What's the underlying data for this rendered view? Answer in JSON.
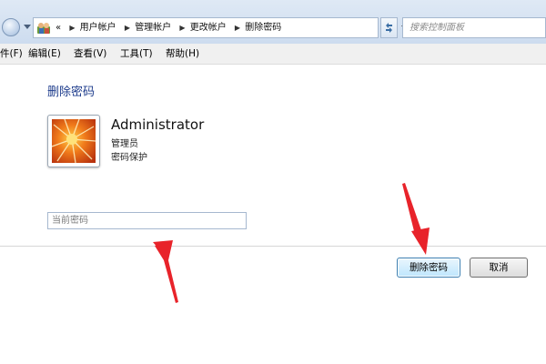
{
  "breadcrumb": {
    "chevron": "«",
    "items": [
      "用户帐户",
      "管理帐户",
      "更改帐户",
      "删除密码"
    ]
  },
  "search": {
    "placeholder": "搜索控制面板"
  },
  "menu": {
    "items": [
      "件(F)",
      "编辑(E)",
      "查看(V)",
      "工具(T)",
      "帮助(H)"
    ]
  },
  "page": {
    "title": "删除密码",
    "user": {
      "name": "Administrator",
      "role": "管理员",
      "protection": "密码保护"
    },
    "password_field": {
      "placeholder": "当前密码",
      "value": ""
    }
  },
  "buttons": {
    "delete": "删除密码",
    "cancel": "取消"
  },
  "icons": {
    "back": "back-arrow-icon",
    "address": "control-panel-users-icon",
    "refresh": "refresh-icon",
    "avatar": "flower-avatar-icon",
    "annotation": "red-arrow-icon"
  },
  "colors": {
    "title": "#1e3c8c",
    "annotation_arrow": "#e8232a",
    "primary_button": "#bee6fd"
  }
}
